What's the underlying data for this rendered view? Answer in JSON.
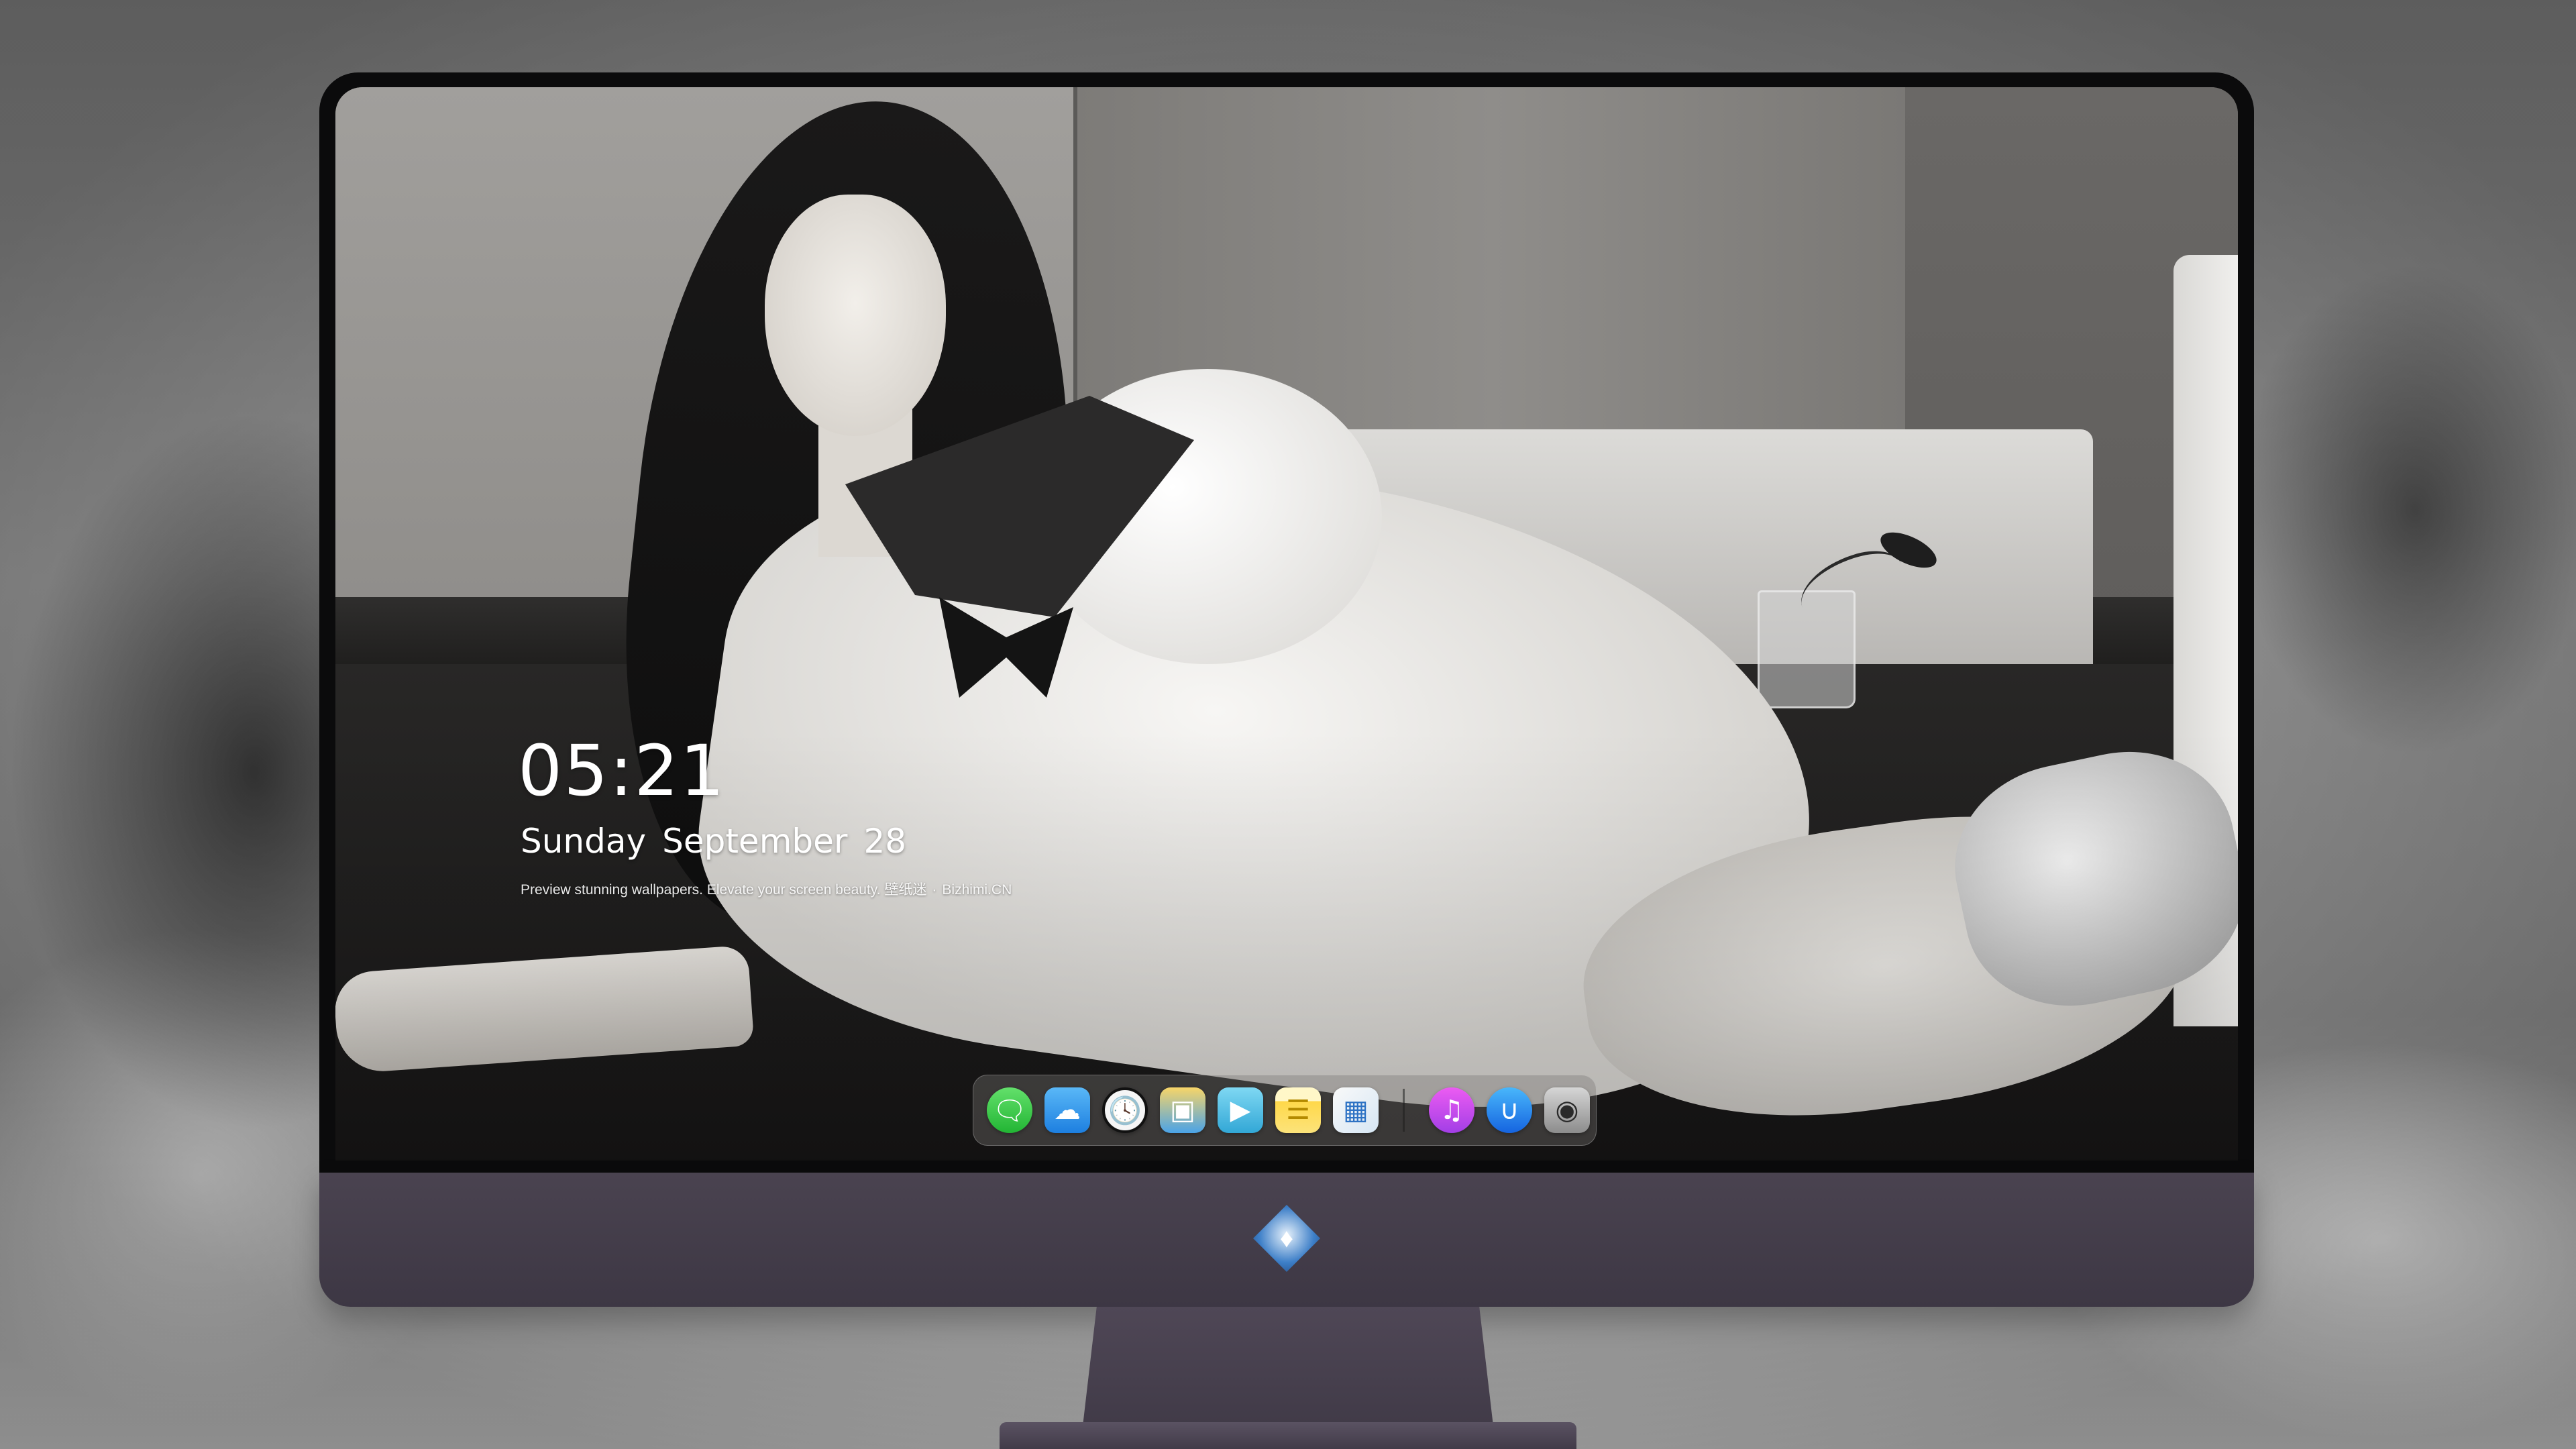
{
  "lock_screen": {
    "time": "05:21",
    "weekday": "Sunday",
    "month": "September",
    "day": "28",
    "tagline_main": "Preview stunning wallpapers. Elevate your screen beauty.",
    "tagline_brand": "壁纸迷",
    "tagline_sep": "·",
    "tagline_site": "Bizhimi.CN"
  },
  "dock": {
    "items": [
      {
        "name": "messages",
        "icon": "speech-bubble"
      },
      {
        "name": "weather",
        "icon": "cloud-sun"
      },
      {
        "name": "clock",
        "icon": "clock-face"
      },
      {
        "name": "preview",
        "icon": "image-viewer"
      },
      {
        "name": "clips",
        "icon": "clapperboard"
      },
      {
        "name": "notes",
        "icon": "notepad"
      },
      {
        "name": "photos",
        "icon": "photo-collage"
      },
      {
        "name": "music",
        "icon": "music-note"
      },
      {
        "name": "app-store",
        "icon": "app-store-a"
      },
      {
        "name": "camera",
        "icon": "camera"
      }
    ]
  },
  "colors": {
    "chin": "#463f4c",
    "bezel": "#0b0b0c",
    "text": "#ffffff"
  }
}
